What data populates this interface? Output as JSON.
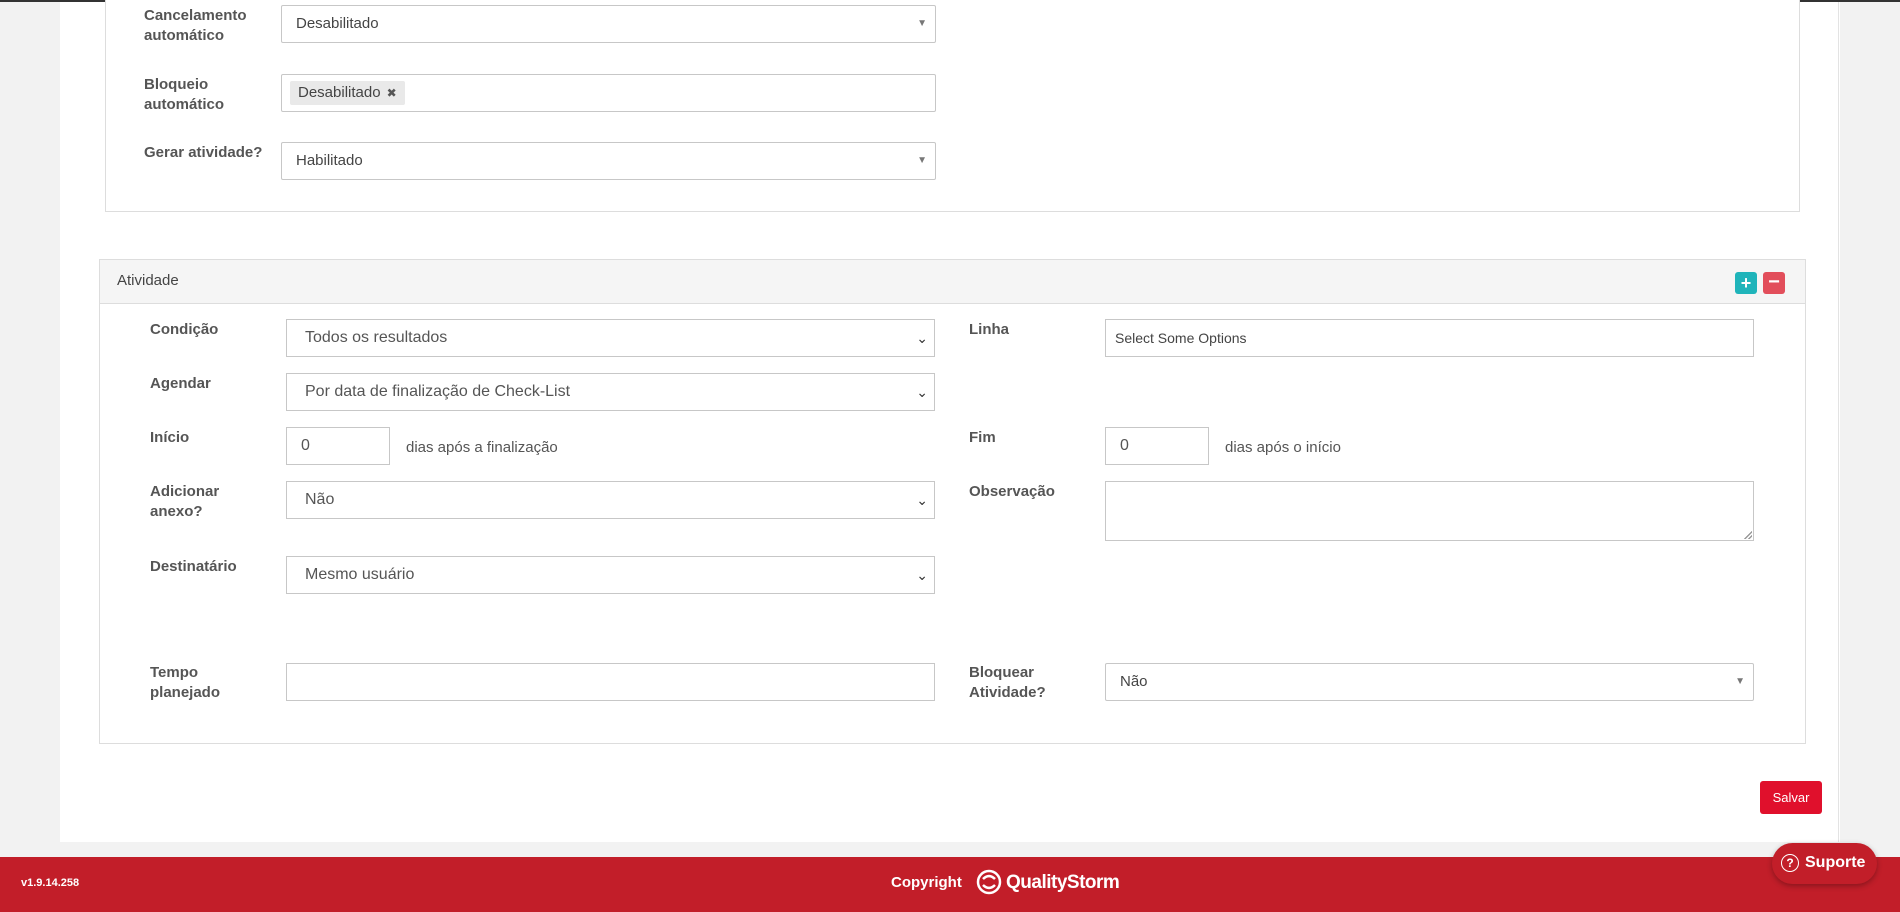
{
  "top_panel": {
    "fields": [
      {
        "label": "Cancelamento automático",
        "value": "Desabilitado"
      },
      {
        "label": "Bloqueio automático",
        "chip": "Desabilitado"
      },
      {
        "label": "Gerar atividade?",
        "value": "Habilitado"
      }
    ]
  },
  "atividade": {
    "title": "Atividade",
    "add_label": "+",
    "remove_label": "−",
    "condicao": {
      "label": "Condição",
      "value": "Todos os resultados"
    },
    "linha": {
      "label": "Linha",
      "placeholder": "Select Some Options"
    },
    "agendar": {
      "label": "Agendar",
      "value": "Por data de finalização de Check-List"
    },
    "inicio": {
      "label": "Início",
      "value": "0",
      "suffix": "dias após a finalização"
    },
    "fim": {
      "label": "Fim",
      "value": "0",
      "suffix": "dias após o início"
    },
    "adicionar_anexo": {
      "label": "Adicionar anexo?",
      "value": "Não"
    },
    "observacao": {
      "label": "Observação",
      "value": ""
    },
    "destinatario": {
      "label": "Destinatário",
      "value": "Mesmo usuário"
    },
    "tempo_planejado": {
      "label": "Tempo planejado",
      "value": ""
    },
    "bloquear_atividade": {
      "label": "Bloquear Atividade?",
      "value": "Não"
    }
  },
  "save_label": "Salvar",
  "footer": {
    "version": "v1.9.14.258",
    "copyright": "Copyright",
    "brand": "QualityStorm",
    "support": "Suporte"
  },
  "colors": {
    "footer_bg": "#c21e29",
    "save_button": "#e0102c",
    "add_button": "#1fb4ba",
    "remove_button": "#e24e5b"
  }
}
